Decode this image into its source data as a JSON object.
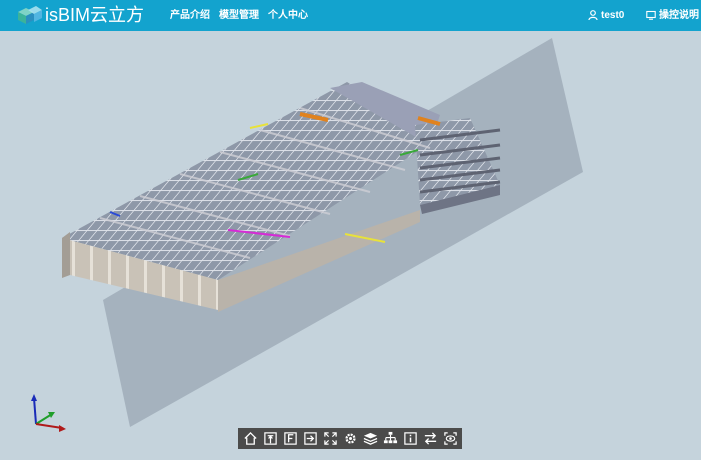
{
  "app": {
    "brand": "isBIM云立方"
  },
  "nav": [
    {
      "label": "产品介绍"
    },
    {
      "label": "模型管理"
    },
    {
      "label": "个人中心"
    }
  ],
  "user": {
    "name": "test0",
    "help_label": "操控说明"
  },
  "toolbar": {
    "tools": [
      "home-icon",
      "top-view-icon",
      "front-view-icon",
      "fit-view-icon",
      "fullscreen-icon",
      "settings-icon",
      "layers-icon",
      "tree-icon",
      "info-icon",
      "swap-icon",
      "visibility-icon"
    ]
  },
  "colors": {
    "header": "#13a3ce",
    "viewport_bg": "#c5d3dc",
    "toolbar": "#4b4b4b"
  }
}
